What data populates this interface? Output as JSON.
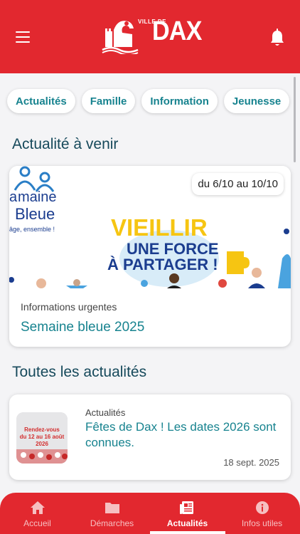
{
  "header": {
    "logo_small": "VILLE DE",
    "logo_big": "DAX",
    "menu_icon": "hamburger-icon",
    "notification_icon": "bell-icon"
  },
  "chips": [
    {
      "label": "Actualités"
    },
    {
      "label": "Famille"
    },
    {
      "label": "Information"
    },
    {
      "label": "Jeunesse"
    }
  ],
  "upcoming": {
    "section_title": "Actualité à venir",
    "card": {
      "date_range": "du 6/10 au 10/10",
      "category": "Informations urgentes",
      "title": "Semaine bleue 2025",
      "image": {
        "logo_line1": "a",
        "logo_line2": "maine",
        "logo_line3": "Bleue",
        "logo_tagline": "âge, ensemble !",
        "headline1": "VIEILLIR",
        "headline2": "UNE FORCE",
        "headline3": "À PARTAGER !"
      }
    }
  },
  "all_news": {
    "section_title": "Toutes les actualités",
    "items": [
      {
        "category": "Actualités",
        "title": "Fêtes de Dax ! Les dates 2026 sont connues.",
        "date": "18 sept. 2025",
        "thumb_text1": "Rendez-vous",
        "thumb_text2": "du 12 au 16 août",
        "thumb_text3": "2026"
      }
    ]
  },
  "tabbar": {
    "tabs": [
      {
        "label": "Accueil",
        "icon": "home-icon"
      },
      {
        "label": "Démarches",
        "icon": "folder-icon"
      },
      {
        "label": "Actualités",
        "icon": "newspaper-icon",
        "active": true
      },
      {
        "label": "Infos utiles",
        "icon": "info-icon"
      }
    ]
  },
  "colors": {
    "brand_red": "#e2282f",
    "teal": "#17838f",
    "dark_teal": "#16495b",
    "background": "#f4f4f6"
  }
}
